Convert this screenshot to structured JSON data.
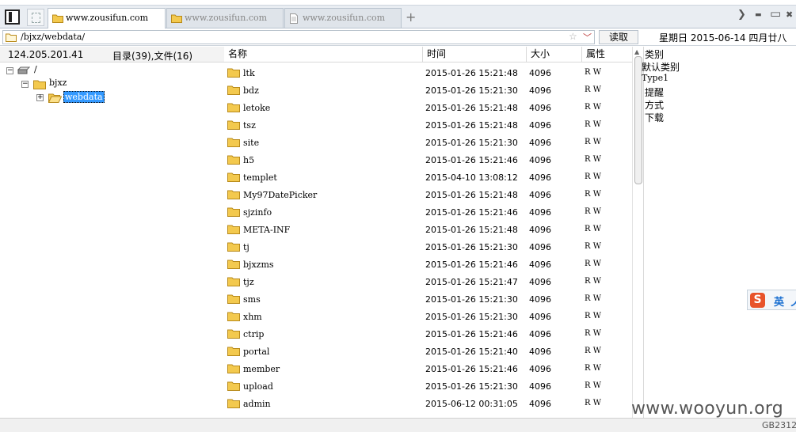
{
  "tabs": [
    {
      "label": "www.zousifun.com",
      "active": true
    },
    {
      "label": "www.zousifun.com",
      "active": false
    },
    {
      "label": "www.zousifun.com",
      "active": false
    }
  ],
  "toolbar": {
    "new_tab_label": "+",
    "chevron_right": "❯",
    "minimize": "▬",
    "maximize": "▭",
    "close": "✖"
  },
  "pathbar": {
    "path": "/bjxz/webdata/",
    "read_button": "读取",
    "star": "☆",
    "chevron": "﹀",
    "date": "星期日 2015-06-14 四月廿八"
  },
  "left_header": {
    "ip": "124.205.201.41",
    "counts": "目录(39),文件(16)"
  },
  "tree": [
    {
      "label": "/",
      "toggle": "−",
      "icon": "drive-icon"
    },
    {
      "label": "bjxz",
      "toggle": "−",
      "icon": "folder-icon"
    },
    {
      "label": "webdata",
      "toggle": "+",
      "icon": "folder-open-icon",
      "selected": true
    }
  ],
  "columns": {
    "name": "名称",
    "time": "时间",
    "size": "大小",
    "attr": "属性"
  },
  "files": [
    {
      "name": "ltk",
      "time": "2015-01-26 15:21:48",
      "size": "4096",
      "attr": "R W"
    },
    {
      "name": "bdz",
      "time": "2015-01-26 15:21:30",
      "size": "4096",
      "attr": "R W"
    },
    {
      "name": "letoke",
      "time": "2015-01-26 15:21:48",
      "size": "4096",
      "attr": "R W"
    },
    {
      "name": "tsz",
      "time": "2015-01-26 15:21:48",
      "size": "4096",
      "attr": "R W"
    },
    {
      "name": "site",
      "time": "2015-01-26 15:21:30",
      "size": "4096",
      "attr": "R W"
    },
    {
      "name": "h5",
      "time": "2015-01-26 15:21:46",
      "size": "4096",
      "attr": "R W"
    },
    {
      "name": "templet",
      "time": "2015-04-10 13:08:12",
      "size": "4096",
      "attr": "R W"
    },
    {
      "name": "My97DatePicker",
      "time": "2015-01-26 15:21:48",
      "size": "4096",
      "attr": "R W"
    },
    {
      "name": "sjzinfo",
      "time": "2015-01-26 15:21:46",
      "size": "4096",
      "attr": "R W"
    },
    {
      "name": "META-INF",
      "time": "2015-01-26 15:21:48",
      "size": "4096",
      "attr": "R W"
    },
    {
      "name": "tj",
      "time": "2015-01-26 15:21:30",
      "size": "4096",
      "attr": "R W"
    },
    {
      "name": "bjxzms",
      "time": "2015-01-26 15:21:46",
      "size": "4096",
      "attr": "R W"
    },
    {
      "name": "tjz",
      "time": "2015-01-26 15:21:47",
      "size": "4096",
      "attr": "R W"
    },
    {
      "name": "sms",
      "time": "2015-01-26 15:21:30",
      "size": "4096",
      "attr": "R W"
    },
    {
      "name": "xhm",
      "time": "2015-01-26 15:21:30",
      "size": "4096",
      "attr": "R W"
    },
    {
      "name": "ctrip",
      "time": "2015-01-26 15:21:46",
      "size": "4096",
      "attr": "R W"
    },
    {
      "name": "portal",
      "time": "2015-01-26 15:21:40",
      "size": "4096",
      "attr": "R W"
    },
    {
      "name": "member",
      "time": "2015-01-26 15:21:46",
      "size": "4096",
      "attr": "R W"
    },
    {
      "name": "upload",
      "time": "2015-01-26 15:21:30",
      "size": "4096",
      "attr": "R W"
    },
    {
      "name": "admin",
      "time": "2015-06-12 00:31:05",
      "size": "4096",
      "attr": "R W"
    }
  ],
  "right_pane": [
    "类别",
    "默认类别",
    "Type1",
    "提醒",
    "方式",
    "下载"
  ],
  "ime": {
    "logo": "S",
    "mode": "英",
    "extra": "ノ"
  },
  "watermark": "www.wooyun.org",
  "bottom_right": "GB2312",
  "colors": {
    "selection": "#3399ff",
    "folder": "#f3c94e",
    "folder_stroke": "#b88a1a",
    "ime_logo": "#e8532b"
  }
}
